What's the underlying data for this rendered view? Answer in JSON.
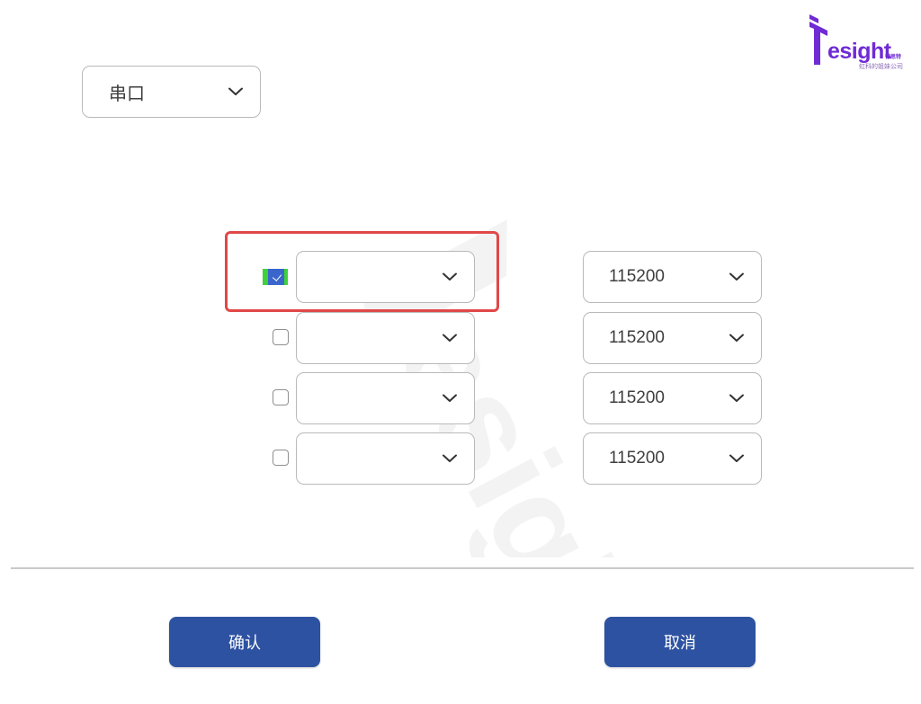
{
  "logo": {
    "word": "esight",
    "cn": "德思特",
    "tagline": "虹科的姐妹公司",
    "colors": {
      "brand": "#6f2bd4"
    }
  },
  "port_select": {
    "value": "串口"
  },
  "rows": [
    {
      "checked": true,
      "device": "",
      "baud": "115200"
    },
    {
      "checked": false,
      "device": "",
      "baud": "115200"
    },
    {
      "checked": false,
      "device": "",
      "baud": "115200"
    },
    {
      "checked": false,
      "device": "",
      "baud": "115200"
    }
  ],
  "buttons": {
    "confirm": "确认",
    "cancel": "取消"
  },
  "colors": {
    "button_bg": "#2e52a2",
    "highlight": "#e04848",
    "checkbox_checked": "#3a66cc"
  },
  "icons": {
    "dropdown": "chevron-down-icon",
    "logo": "tesight-logo"
  }
}
